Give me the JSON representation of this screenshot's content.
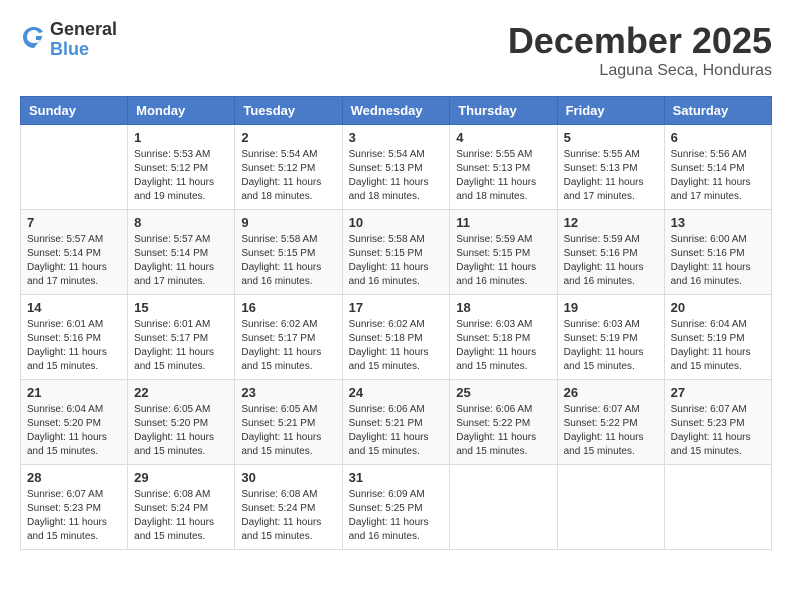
{
  "header": {
    "logo_general": "General",
    "logo_blue": "Blue",
    "month": "December 2025",
    "location": "Laguna Seca, Honduras"
  },
  "weekdays": [
    "Sunday",
    "Monday",
    "Tuesday",
    "Wednesday",
    "Thursday",
    "Friday",
    "Saturday"
  ],
  "weeks": [
    [
      {
        "day": "",
        "info": ""
      },
      {
        "day": "1",
        "info": "Sunrise: 5:53 AM\nSunset: 5:12 PM\nDaylight: 11 hours\nand 19 minutes."
      },
      {
        "day": "2",
        "info": "Sunrise: 5:54 AM\nSunset: 5:12 PM\nDaylight: 11 hours\nand 18 minutes."
      },
      {
        "day": "3",
        "info": "Sunrise: 5:54 AM\nSunset: 5:13 PM\nDaylight: 11 hours\nand 18 minutes."
      },
      {
        "day": "4",
        "info": "Sunrise: 5:55 AM\nSunset: 5:13 PM\nDaylight: 11 hours\nand 18 minutes."
      },
      {
        "day": "5",
        "info": "Sunrise: 5:55 AM\nSunset: 5:13 PM\nDaylight: 11 hours\nand 17 minutes."
      },
      {
        "day": "6",
        "info": "Sunrise: 5:56 AM\nSunset: 5:14 PM\nDaylight: 11 hours\nand 17 minutes."
      }
    ],
    [
      {
        "day": "7",
        "info": "Sunrise: 5:57 AM\nSunset: 5:14 PM\nDaylight: 11 hours\nand 17 minutes."
      },
      {
        "day": "8",
        "info": "Sunrise: 5:57 AM\nSunset: 5:14 PM\nDaylight: 11 hours\nand 17 minutes."
      },
      {
        "day": "9",
        "info": "Sunrise: 5:58 AM\nSunset: 5:15 PM\nDaylight: 11 hours\nand 16 minutes."
      },
      {
        "day": "10",
        "info": "Sunrise: 5:58 AM\nSunset: 5:15 PM\nDaylight: 11 hours\nand 16 minutes."
      },
      {
        "day": "11",
        "info": "Sunrise: 5:59 AM\nSunset: 5:15 PM\nDaylight: 11 hours\nand 16 minutes."
      },
      {
        "day": "12",
        "info": "Sunrise: 5:59 AM\nSunset: 5:16 PM\nDaylight: 11 hours\nand 16 minutes."
      },
      {
        "day": "13",
        "info": "Sunrise: 6:00 AM\nSunset: 5:16 PM\nDaylight: 11 hours\nand 16 minutes."
      }
    ],
    [
      {
        "day": "14",
        "info": "Sunrise: 6:01 AM\nSunset: 5:16 PM\nDaylight: 11 hours\nand 15 minutes."
      },
      {
        "day": "15",
        "info": "Sunrise: 6:01 AM\nSunset: 5:17 PM\nDaylight: 11 hours\nand 15 minutes."
      },
      {
        "day": "16",
        "info": "Sunrise: 6:02 AM\nSunset: 5:17 PM\nDaylight: 11 hours\nand 15 minutes."
      },
      {
        "day": "17",
        "info": "Sunrise: 6:02 AM\nSunset: 5:18 PM\nDaylight: 11 hours\nand 15 minutes."
      },
      {
        "day": "18",
        "info": "Sunrise: 6:03 AM\nSunset: 5:18 PM\nDaylight: 11 hours\nand 15 minutes."
      },
      {
        "day": "19",
        "info": "Sunrise: 6:03 AM\nSunset: 5:19 PM\nDaylight: 11 hours\nand 15 minutes."
      },
      {
        "day": "20",
        "info": "Sunrise: 6:04 AM\nSunset: 5:19 PM\nDaylight: 11 hours\nand 15 minutes."
      }
    ],
    [
      {
        "day": "21",
        "info": "Sunrise: 6:04 AM\nSunset: 5:20 PM\nDaylight: 11 hours\nand 15 minutes."
      },
      {
        "day": "22",
        "info": "Sunrise: 6:05 AM\nSunset: 5:20 PM\nDaylight: 11 hours\nand 15 minutes."
      },
      {
        "day": "23",
        "info": "Sunrise: 6:05 AM\nSunset: 5:21 PM\nDaylight: 11 hours\nand 15 minutes."
      },
      {
        "day": "24",
        "info": "Sunrise: 6:06 AM\nSunset: 5:21 PM\nDaylight: 11 hours\nand 15 minutes."
      },
      {
        "day": "25",
        "info": "Sunrise: 6:06 AM\nSunset: 5:22 PM\nDaylight: 11 hours\nand 15 minutes."
      },
      {
        "day": "26",
        "info": "Sunrise: 6:07 AM\nSunset: 5:22 PM\nDaylight: 11 hours\nand 15 minutes."
      },
      {
        "day": "27",
        "info": "Sunrise: 6:07 AM\nSunset: 5:23 PM\nDaylight: 11 hours\nand 15 minutes."
      }
    ],
    [
      {
        "day": "28",
        "info": "Sunrise: 6:07 AM\nSunset: 5:23 PM\nDaylight: 11 hours\nand 15 minutes."
      },
      {
        "day": "29",
        "info": "Sunrise: 6:08 AM\nSunset: 5:24 PM\nDaylight: 11 hours\nand 15 minutes."
      },
      {
        "day": "30",
        "info": "Sunrise: 6:08 AM\nSunset: 5:24 PM\nDaylight: 11 hours\nand 15 minutes."
      },
      {
        "day": "31",
        "info": "Sunrise: 6:09 AM\nSunset: 5:25 PM\nDaylight: 11 hours\nand 16 minutes."
      },
      {
        "day": "",
        "info": ""
      },
      {
        "day": "",
        "info": ""
      },
      {
        "day": "",
        "info": ""
      }
    ]
  ]
}
